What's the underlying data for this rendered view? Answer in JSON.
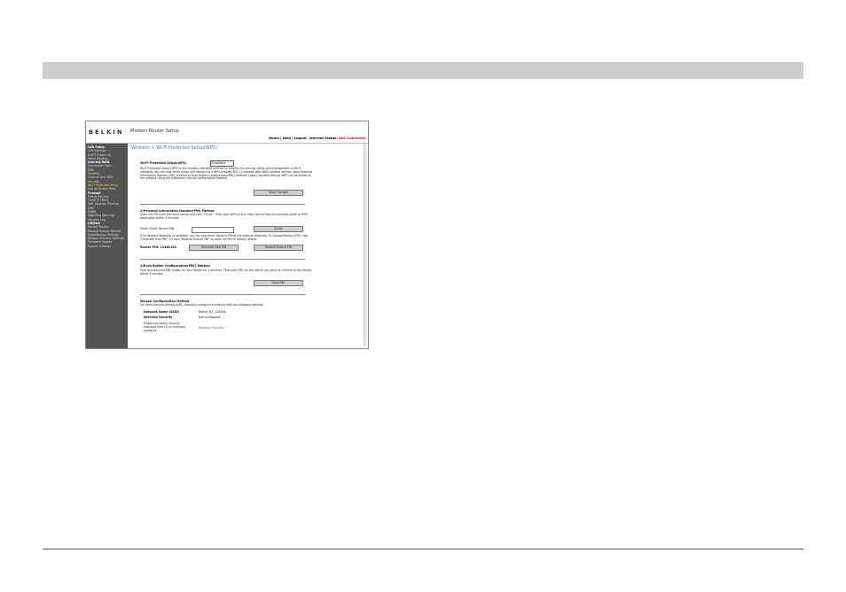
{
  "page": {
    "header_band": ""
  },
  "embedded": {
    "logo_text": "BELKIN",
    "app_title": "Modem-Router Setup",
    "toplinks": {
      "home": "Home",
      "help": "Help",
      "logout": "Logout",
      "status_label": "Internet Status:",
      "status_value": "Not Connected"
    },
    "sidebar": [
      {
        "label": "LAN Setup",
        "type": "section"
      },
      {
        "label": "LAN Settings",
        "type": "item"
      },
      {
        "label": "DHCP Client List",
        "type": "item"
      },
      {
        "label": "Static Routing",
        "type": "item"
      },
      {
        "label": "Internet WAN",
        "type": "section"
      },
      {
        "label": "Connection Type",
        "type": "item"
      },
      {
        "label": "DNS",
        "type": "item"
      },
      {
        "label": "Wireless",
        "type": "selected"
      },
      {
        "label": "Channel and SSID",
        "type": "item"
      },
      {
        "label": "Security",
        "type": "item"
      },
      {
        "label": "Wi-Fi Protected Setup",
        "type": "selected"
      },
      {
        "label": "Use as Access Point",
        "type": "item"
      },
      {
        "label": "Firewall",
        "type": "section"
      },
      {
        "label": "Virtual Servers",
        "type": "item"
      },
      {
        "label": "Client IP Filters",
        "type": "item"
      },
      {
        "label": "MAC Address Filtering",
        "type": "item"
      },
      {
        "label": "DMZ",
        "type": "item"
      },
      {
        "label": "DDNS",
        "type": "item"
      },
      {
        "label": "WAN Ping Blocking",
        "type": "item"
      },
      {
        "label": "Security Log",
        "type": "item"
      },
      {
        "label": "Utilities",
        "type": "section"
      },
      {
        "label": "Restart Router",
        "type": "item"
      },
      {
        "label": "Restore Factory Default",
        "type": "item"
      },
      {
        "label": "Save/Backup Settings",
        "type": "item"
      },
      {
        "label": "Restore Previous Settings",
        "type": "item"
      },
      {
        "label": "Firmware Update",
        "type": "item"
      },
      {
        "label": "System Settings",
        "type": "item"
      }
    ],
    "main": {
      "title": "Wireless > Wi-Fi Protected Setup(WPS)",
      "wps_label": "Wi-Fi Protected Setup(WPS)",
      "wps_select": "Enabled",
      "intro": "Wi-Fi Protected Setup (WPS) is the industry standard method to simplify the security setup and management of Wi-Fi networks. You can now easily setup and connect to a WPS-enabled 802.11 network with WPA-certified devices using Personal Information Number (PIN) method or Push Button Configuration(PBC) method. Legacy devices without WPS can be added to the network using the traditional manual configuration method.",
      "save_btn": "Save Changes",
      "pin_heading": "1)Personal Information Number(PIN) Method",
      "pin_text": "Enter the PIN from the client device and click \"Enroll\". Then start WPS on the client device from it's wireless utility or WPS application within 2 minutes.",
      "pin_input_label": "Enter Client Device PIN",
      "enroll_btn": "Enroll",
      "registrar_text": "If an external Registrar is available, you can also enter Router's PIN at the external Registrar. To change Router's PIN, click \"Generate New PIN\". Or click \"Restore Default PIN\" to reset the PIN to factory default.",
      "router_pin_label": "Router PIN: 11482143",
      "gen_btn": "Generate New PIN",
      "restore_btn": "Restore Default PIN",
      "pbc_heading": "2)Push Button Configuration(PBC) Method",
      "pbc_text": "Push and hold the PBC button on your Router for 3 seconds. Then start PBC on the device you want to connect to the Router within 2 minutes.",
      "pbc_btn": "Start PBC",
      "manual_heading": "Manual Configuration Method",
      "manual_text": "For client devices without WPS, manually configure the device with the following settings:",
      "ssid_label": "Network Name (SSID)",
      "ssid_value": "Belkin_N1_123456",
      "security_label": "Wireless Security",
      "security_value": "Not configured",
      "note_text": "Please use Belkin Security Assistant from CD or manually configure",
      "security_link": "Wireless Security"
    }
  }
}
